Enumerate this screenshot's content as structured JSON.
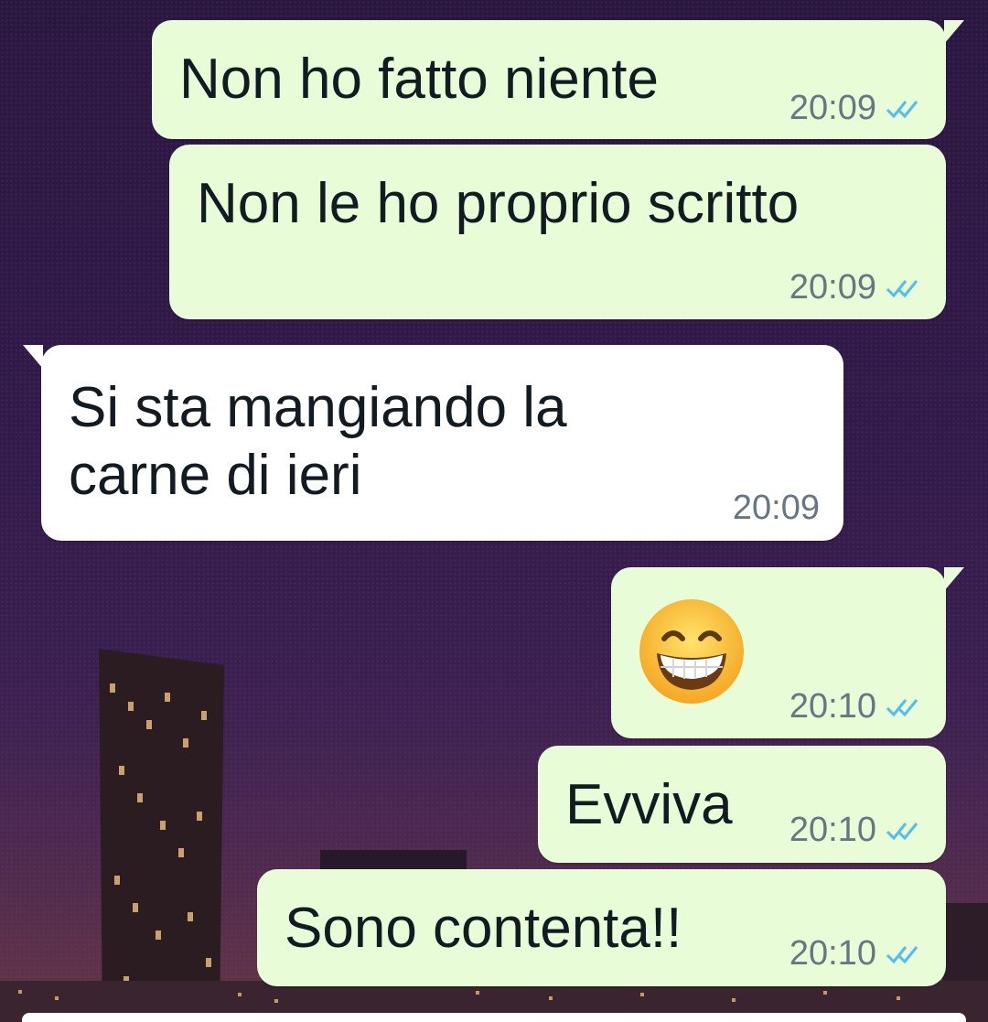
{
  "messages": [
    {
      "text": "Non ho fatto niente",
      "time": "20:09",
      "direction": "outgoing",
      "status": "read"
    },
    {
      "text": "Non le ho proprio scritto",
      "time": "20:09",
      "direction": "outgoing",
      "status": "read"
    },
    {
      "text": "Si sta mangiando la\ncarne di ieri",
      "time": "20:09",
      "direction": "incoming"
    },
    {
      "emoji": "grinning-face-with-smiling-eyes",
      "time": "20:10",
      "direction": "outgoing",
      "status": "read"
    },
    {
      "text": "Evviva",
      "time": "20:10",
      "direction": "outgoing",
      "status": "read"
    },
    {
      "text": "Sono contenta!!",
      "time": "20:10",
      "direction": "outgoing",
      "status": "read"
    }
  ],
  "colors": {
    "outgoing_bubble": "#e7fcd7",
    "incoming_bubble": "#ffffff",
    "read_ticks": "#53bdeb",
    "timestamp": "#667781"
  }
}
